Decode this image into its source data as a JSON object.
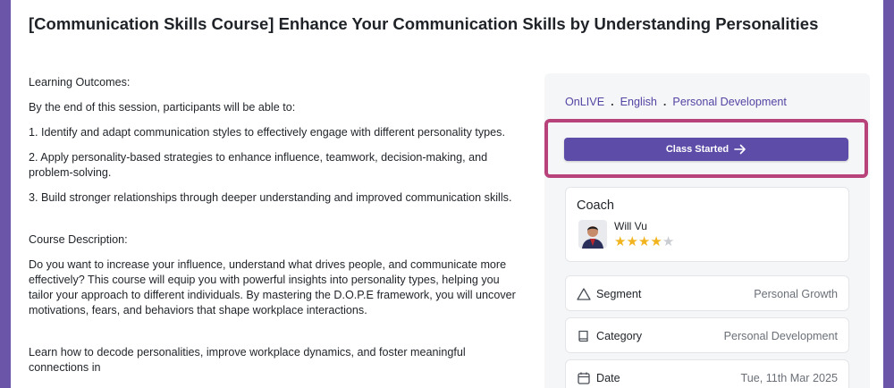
{
  "page": {
    "title": "[Communication Skills Course] Enhance Your Communication Skills by Understanding Personalities"
  },
  "content": {
    "paragraphs": [
      "Learning Outcomes:",
      "By the end of this session, participants will be able to:",
      "1. Identify and adapt communication styles to effectively engage with different personality types.",
      "2. Apply personality-based strategies to enhance influence, teamwork, decision-making, and problem-solving.",
      "3. Build stronger relationships through deeper understanding and improved communication skills.",
      "Course Description:",
      "Do you want to increase your influence, understand what drives people, and communicate more effectively? This course will equip you with powerful insights into personality types, helping you tailor your approach to different individuals. By mastering the D.O.P.E framework, you will uncover motivations, fears, and behaviors that shape workplace interactions.",
      "Learn how to decode personalities, improve workplace dynamics, and foster meaningful connections in"
    ]
  },
  "sidebar": {
    "tags": [
      "OnLIVE",
      "English",
      "Personal Development"
    ],
    "tag_separator": ".",
    "start_button_label": "Class Started",
    "coach": {
      "heading": "Coach",
      "name": "Will Vu",
      "rating": 4,
      "max_rating": 5
    },
    "info": [
      {
        "icon": "triangle-icon",
        "label": "Segment",
        "value": "Personal Growth"
      },
      {
        "icon": "book-icon",
        "label": "Category",
        "value": "Personal Development"
      },
      {
        "icon": "calendar-icon",
        "label": "Date",
        "value": "Tue, 11th Mar 2025"
      }
    ]
  },
  "colors": {
    "accent": "#5d4ca8",
    "highlight_border": "#b8427a",
    "star": "#f2b41e"
  }
}
